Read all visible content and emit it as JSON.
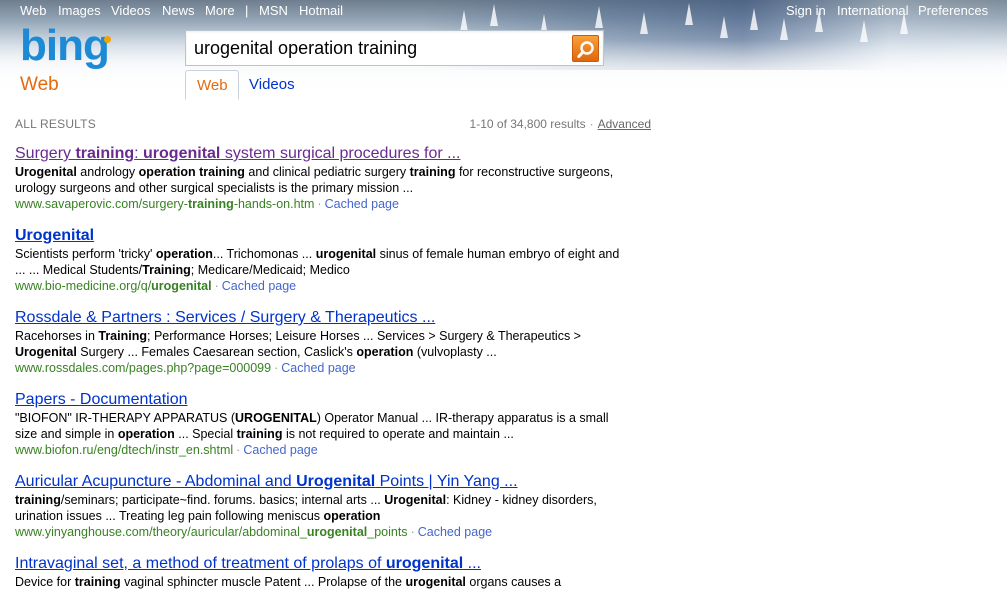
{
  "topnav": {
    "left": [
      "Web",
      "Images",
      "Videos",
      "News",
      "More",
      "MSN",
      "Hotmail"
    ],
    "right": [
      "Sign in",
      "International",
      "Preferences"
    ]
  },
  "brand": {
    "logo": "bing",
    "section": "Web"
  },
  "search": {
    "query": "urogenital operation training"
  },
  "tabs": [
    {
      "label": "Web",
      "active": true
    },
    {
      "label": "Videos",
      "active": false
    }
  ],
  "results_bar": {
    "all_results": "ALL RESULTS",
    "count": "1-10 of 34,800 results",
    "advanced": "Advanced"
  },
  "results": [
    {
      "title": "Surgery training: urogenital system surgical procedures for ...",
      "visited": true,
      "snippet": "Urogenital andrology operation training and clinical pediatric surgery training for reconstructive surgeons, urology surgeons and other surgical specialists is the primary mission ...",
      "url": "www.savaperovic.com/surgery-training-hands-on.htm",
      "cached": "Cached page"
    },
    {
      "title": "Urogenital",
      "visited": false,
      "snippet": "Scientists perform 'tricky' operation... Trichomonas ... urogenital sinus of female human embryo of eight and ... ... Medical Students/Training; Medicare/Medicaid; Medico",
      "url": "www.bio-medicine.org/q/urogenital",
      "cached": "Cached page"
    },
    {
      "title": "Rossdale & Partners : Services / Surgery & Therapeutics ...",
      "visited": false,
      "snippet": "Racehorses in Training; Performance Horses; Leisure Horses ... Services > Surgery & Therapeutics > Urogenital Surgery ... Females Caesarean section, Caslick's operation (vulvoplasty ...",
      "url": "www.rossdales.com/pages.php?page=000099",
      "cached": "Cached page"
    },
    {
      "title": "Papers - Documentation",
      "visited": false,
      "snippet": "\"BIOFON\" IR-THERAPY APPARATUS (UROGENITAL) Operator Manual ... IR-therapy apparatus is a small size and simple in operation ... Special training is not required to operate and maintain ...",
      "url": "www.biofon.ru/eng/dtech/instr_en.shtml",
      "cached": "Cached page"
    },
    {
      "title": "Auricular Acupuncture - Abdominal and Urogenital Points | Yin Yang ...",
      "visited": false,
      "snippet": "training/seminars; participate~find. forums. basics; internal arts ... Urogenital: Kidney - kidney disorders, urination issues ... Treating leg pain following meniscus operation",
      "url": "www.yinyanghouse.com/theory/auricular/abdominal_urogenital_points",
      "cached": "Cached page"
    },
    {
      "title": "Intravaginal set, a method of treatment of prolaps of urogenital ...",
      "visited": false,
      "snippet": "Device for training vaginal sphincter muscle Patent ... Prolapse of the urogenital organs causes a",
      "url": "",
      "cached": ""
    }
  ]
}
